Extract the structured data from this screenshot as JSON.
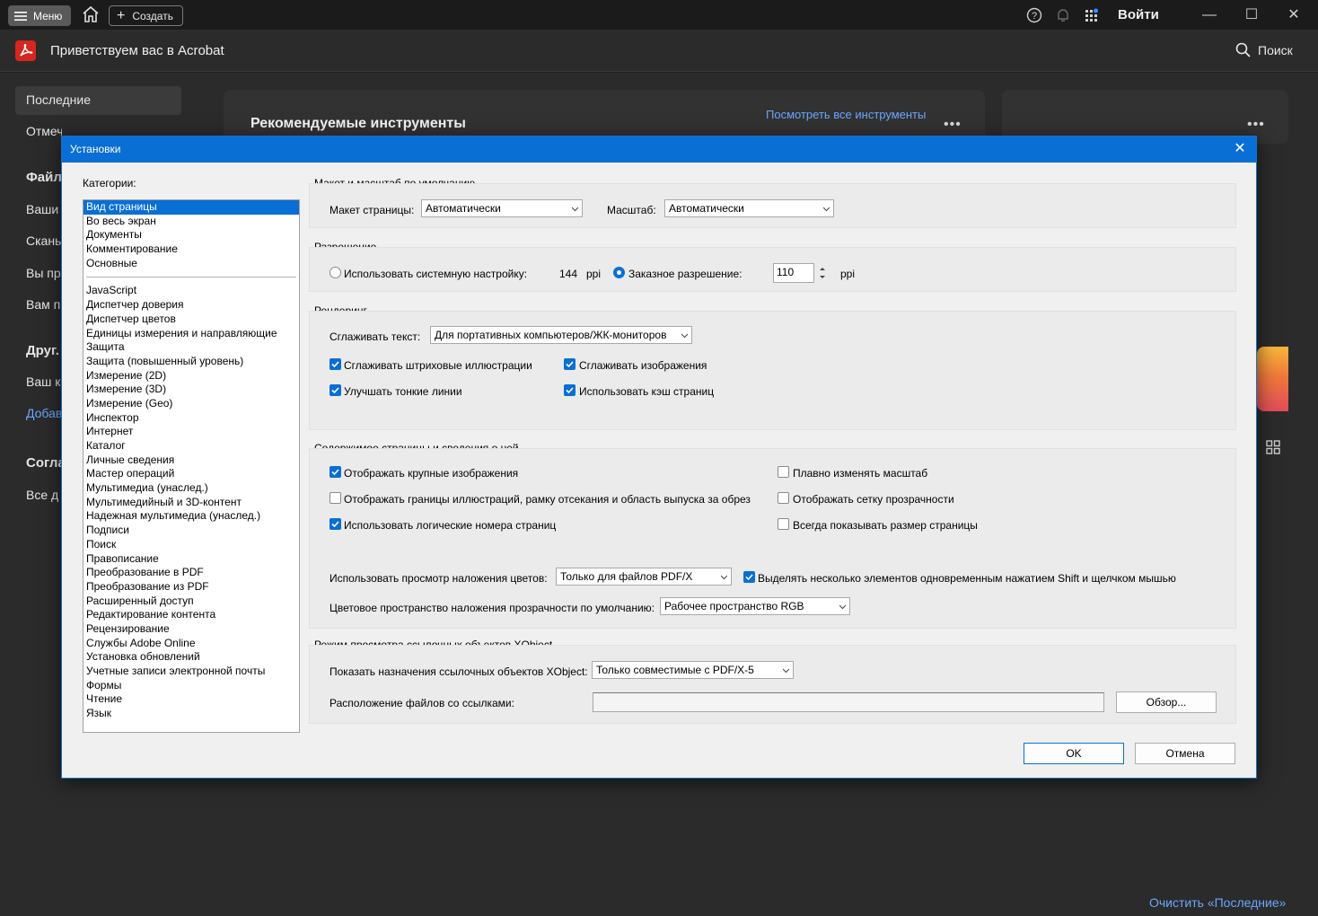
{
  "titlebar": {
    "menu_label": "Меню",
    "create_label": "Создать",
    "login_label": "Войти"
  },
  "appheader": {
    "welcome": "Приветствуем вас в Acrobat",
    "search_label": "Поиск"
  },
  "sidebar": {
    "recent": "Последние",
    "starred": "Отмечено",
    "files_heading": "Файл",
    "items_files": [
      "Ваши",
      "Скань",
      "Вы пр",
      "Вам п"
    ],
    "other_heading": "Друг.",
    "items_other": [
      "Ваш к",
      "Добав"
    ],
    "agreements_heading": "Согла",
    "agreements_item": "Все д"
  },
  "home": {
    "recommended_title": "Рекомендуемые инструменты",
    "see_all_tools": "Посмотреть все инструменты",
    "clear_recent": "Очистить «Последние»"
  },
  "dialog": {
    "title": "Установки",
    "categories_label": "Категории:",
    "categories_top": [
      "Вид страницы",
      "Во весь экран",
      "Документы",
      "Комментирование",
      "Основные"
    ],
    "categories_rest": [
      "JavaScript",
      "Диспетчер доверия",
      "Диспетчер цветов",
      "Единицы измерения и направляющие",
      "Защита",
      "Защита (повышенный уровень)",
      "Измерение (2D)",
      "Измерение (3D)",
      "Измерение (Geo)",
      "Инспектор",
      "Интернет",
      "Каталог",
      "Личные сведения",
      "Мастер операций",
      "Мультимедиа (унаслед.)",
      "Мультимедийный и 3D-контент",
      "Надежная мультимедиа (унаслед.)",
      "Подписи",
      "Поиск",
      "Правописание",
      "Преобразование в PDF",
      "Преобразование из PDF",
      "Расширенный доступ",
      "Редактирование контента",
      "Рецензирование",
      "Службы Adobe Online",
      "Установка обновлений",
      "Учетные записи электронной почты",
      "Формы",
      "Чтение",
      "Язык"
    ],
    "layout": {
      "title": "Макет и масштаб по умолчанию",
      "page_layout_label": "Макет страницы:",
      "page_layout_value": "Автоматически",
      "zoom_label": "Масштаб:",
      "zoom_value": "Автоматически"
    },
    "resolution": {
      "title": "Разрешение",
      "system_label": "Использовать системную настройку:",
      "system_value": "144",
      "ppi": "ppi",
      "custom_label": "Заказное разрешение:",
      "custom_value": "110",
      "system_selected": false,
      "custom_selected": true
    },
    "rendering": {
      "title": "Рендеринг",
      "smooth_text_label": "Сглаживать текст:",
      "smooth_text_value": "Для портативных компьютеров/ЖК-мониторов",
      "smooth_lineart": "Сглаживать штриховые иллюстрации",
      "smooth_images": "Сглаживать изображения",
      "enhance_thin_lines": "Улучшать тонкие линии",
      "use_page_cache": "Использовать кэш страниц"
    },
    "content": {
      "title": "Содержимое страницы и сведения о ней",
      "show_large_images": "Отображать крупные изображения",
      "smooth_zoom": "Плавно изменять масштаб",
      "show_art_trim_bleed": "Отображать границы иллюстраций, рамку отсекания и область выпуска за обрез",
      "show_transparency_grid": "Отображать сетку прозрачности",
      "use_logical_numbers": "Использовать логические номера страниц",
      "always_show_page_size": "Всегда показывать размер страницы",
      "overprint_label": "Использовать просмотр наложения цветов:",
      "overprint_value": "Только для файлов PDF/X",
      "multiselect_label": "Выделять несколько элементов одновременным нажатием Shift и щелчком мышью",
      "blend_space_label": "Цветовое пространство наложения прозрачности по умолчанию:",
      "blend_space_value": "Рабочее пространство RGB"
    },
    "xobject": {
      "title": "Режим просмотра ссылочных объектов XObject",
      "show_targets_label": "Показать назначения ссылочных объектов XObject:",
      "show_targets_value": "Только совместимые с PDF/X-5",
      "location_label": "Расположение файлов со ссылками:",
      "location_value": "",
      "browse_label": "Обзор..."
    },
    "ok_label": "OK",
    "cancel_label": "Отмена"
  },
  "colors": {
    "accent": "#0a6fd4",
    "link": "#6aa7ff",
    "acrobat_red": "#d7261e"
  }
}
